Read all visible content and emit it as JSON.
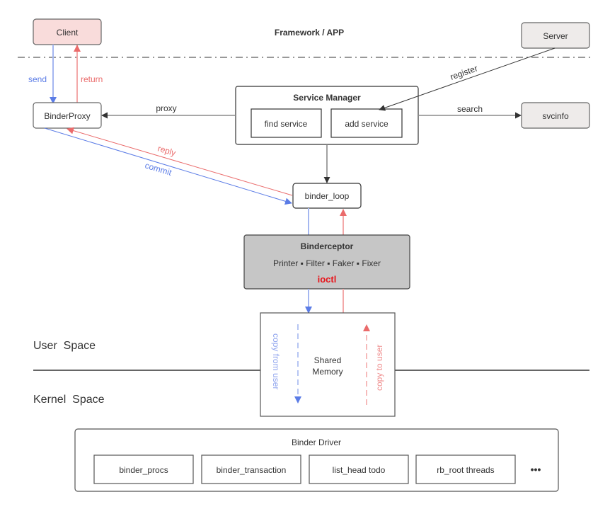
{
  "header": {
    "layer_label": "Framework / APP"
  },
  "colors": {
    "blue": "#5b7ce6",
    "blue_light": "#a5b7f0",
    "red": "#ea6b6b",
    "red_light": "#f3a9a9",
    "client_fill": "#f9dcdb",
    "server_fill": "#eeebea",
    "binderceptor_fill": "#c6c6c6",
    "ioctl_red": "#e8141a",
    "dark": "#333333",
    "gray_line": "#8a8a8a"
  },
  "nodes": {
    "client": "Client",
    "server": "Server",
    "binder_proxy": "BinderProxy",
    "service_manager": {
      "title": "Service Manager",
      "find_service": "find service",
      "add_service": "add service"
    },
    "svcinfo": "svcinfo",
    "binder_loop": "binder_loop",
    "binderceptor": {
      "title": "Binderceptor",
      "modules": "Printer ▪ Filter ▪ Faker ▪ Fixer",
      "ioctl": "ioctl"
    },
    "shared_memory": {
      "line1": "Shared",
      "line2": "Memory",
      "copy_from_user": "copy from user",
      "copy_to_user": "copy to user"
    },
    "binder_driver": {
      "title": "Binder Driver",
      "items": [
        "binder_procs",
        "binder_transaction",
        "list_head todo",
        "rb_root threads"
      ],
      "more": "•••"
    }
  },
  "edges": {
    "send": "send",
    "return": "return",
    "proxy": "proxy",
    "register": "register",
    "search": "search",
    "reply": "reply",
    "commit": "commit"
  },
  "spaces": {
    "user": "User  Space",
    "kernel": "Kernel  Space"
  }
}
